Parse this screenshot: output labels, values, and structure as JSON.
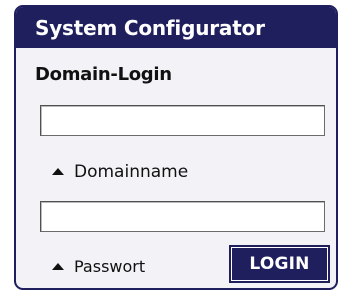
{
  "window": {
    "title": "System Configurator"
  },
  "form": {
    "heading": "Domain-Login",
    "domain": {
      "value": "",
      "label": "Domainname"
    },
    "password": {
      "value": "",
      "label": "Passwort"
    },
    "login_label": "LOGIN"
  },
  "colors": {
    "accent": "#1f1f5e",
    "panel_background": "#f3f3f7",
    "text": "#111111"
  },
  "icons": {
    "label_marker": "triangle-up-icon"
  }
}
